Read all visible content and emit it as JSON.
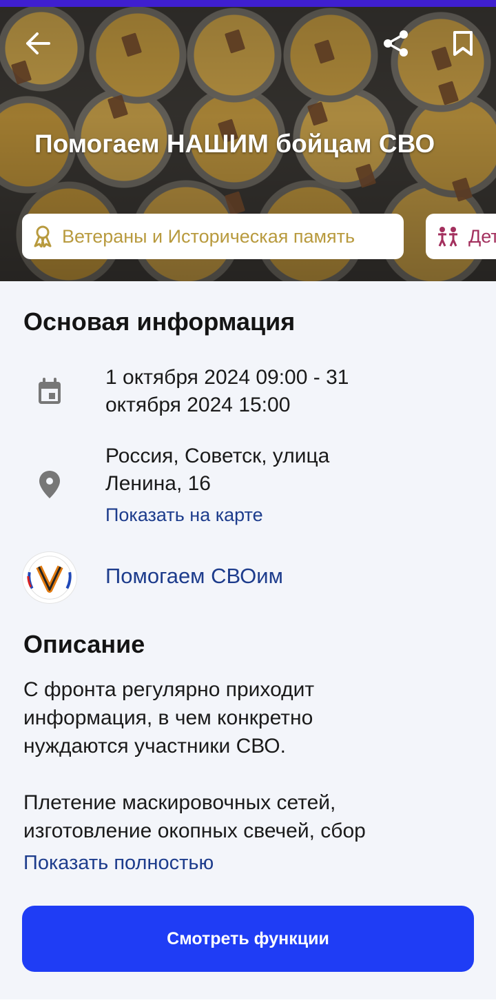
{
  "event": {
    "title": "Помогаем НАШИМ бойцам СВО",
    "categories": [
      {
        "label": "Ветераны и Историческая память",
        "icon": "ribbon-icon",
        "color": "#b89a3e"
      },
      {
        "label": "Дети",
        "icon": "children-icon",
        "color": "#a3305e"
      }
    ]
  },
  "header": {
    "back_icon": "arrow-left-icon",
    "share_icon": "share-icon",
    "bookmark_icon": "bookmark-icon"
  },
  "main_info": {
    "title": "Основая информация",
    "date_line1": "1 октября 2024 09:00 - 31",
    "date_line2": "октября 2024 15:00",
    "address_line1": "Россия, Советск, улица",
    "address_line2": "Ленина, 16",
    "map_link": "Показать на карте",
    "organizer": "Помогаем СВОим"
  },
  "description": {
    "title": "Описание",
    "paragraph1": [
      "С фронта регулярно приходит",
      "информация, в чем конкретно",
      "нуждаются участники СВО."
    ],
    "paragraph2": [
      "Плетение маскировочных сетей,",
      "изготовление окопных свечей, сбор"
    ],
    "show_more": "Показать полностью"
  },
  "cta": {
    "label": "Смотреть функции"
  },
  "colors": {
    "accent": "#1f3df5",
    "link": "#1d3c8c",
    "top_bar": "#3f1fd0",
    "background": "#f3f5fa"
  }
}
